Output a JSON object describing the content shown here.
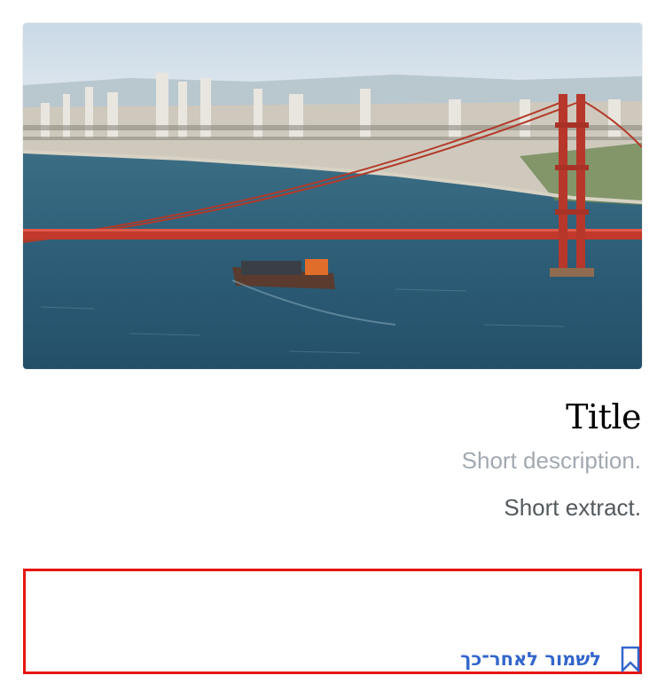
{
  "card": {
    "image": {
      "icon": "golden-gate-bridge-photo",
      "alt": ""
    },
    "title": "Title",
    "description": "Short description.",
    "extract": "Short extract."
  },
  "footer": {
    "save_label": "לשמור לאחר־כך",
    "save_icon": "bookmark-icon"
  },
  "colors": {
    "link": "#3366cc",
    "description": "#a2a9b1",
    "extract": "#54595d",
    "highlight_border": "#e8140e"
  }
}
